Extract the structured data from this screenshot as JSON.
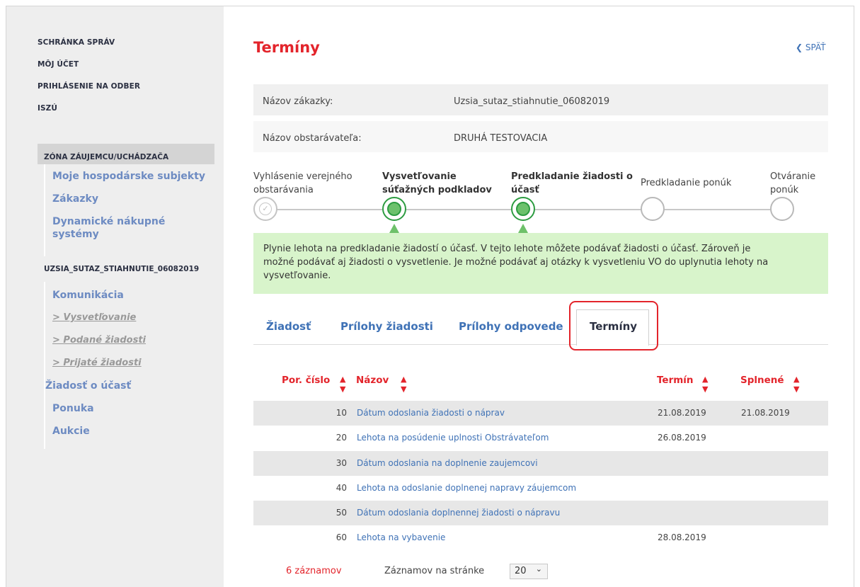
{
  "sidebar": {
    "top_links": [
      "SCHRÁNKA SPRÁV",
      "MÔJ ÚČET",
      "PRIHLÁSENIE NA ODBER",
      "ISZÚ"
    ],
    "zone_header": "ZÓNA ZÁUJEMCU/UCHÁDZAČA",
    "zone_items": [
      "Moje hospodárske subjekty",
      "Zákazky",
      "Dynamické nákupné systémy"
    ],
    "section_header": "UZSIA_SUTAZ_STIAHNUTIE_06082019",
    "section_items": [
      "Komunikácia"
    ],
    "sub_items": [
      "> Vysvetľovanie",
      "> Podané žiadosti",
      "> Prijaté žiadosti"
    ],
    "bottom_items": [
      "Žiadosť o účasť",
      "Ponuka",
      "Aukcie"
    ]
  },
  "page": {
    "title": "Termíny",
    "back_label": "SPÄŤ"
  },
  "info": {
    "contract_label": "Názov zákazky:",
    "contract_value": "Uzsia_sutaz_stiahnutie_06082019",
    "buyer_label": "Názov obstarávateľa:",
    "buyer_value": "DRUHÁ TESTOVACIA"
  },
  "stepper": {
    "steps": [
      {
        "line1": "Vyhlásenie verejného",
        "line2": "obstarávania",
        "state": "done"
      },
      {
        "line1": "Vysvetľovanie",
        "line2": "súťažných podkladov",
        "state": "active"
      },
      {
        "line1": "Predkladanie žiadosti o",
        "line2": "účasť",
        "state": "active"
      },
      {
        "line1": "Predkladanie ponúk",
        "line2": "",
        "state": "pending"
      },
      {
        "line1": "Otváranie",
        "line2": "ponúk",
        "state": "pending"
      }
    ]
  },
  "notice": {
    "line1": "Plynie lehota na predkladanie žiadostí o účasť. V tejto lehote môžete podávať žiadosti o účasť. Zároveň je",
    "line2": "možné podávať aj žiadosti o vysvetlenie. Je možné podávať aj otázky k vysvetleniu VO do uplynutia lehoty na",
    "line3": "vysvetľovanie."
  },
  "tabs": [
    "Žiadosť",
    "Prílohy žiadosti",
    "Prílohy odpovede",
    "Termíny"
  ],
  "table": {
    "headers": [
      "Por. číslo",
      "Názov",
      "Termín",
      "Splnené"
    ],
    "rows": [
      {
        "num": "10",
        "name": "Dátum odoslania žiadosti o náprav",
        "term": "21.08.2019",
        "done": "21.08.2019"
      },
      {
        "num": "20",
        "name": "Lehota na posúdenie uplnosti Obstrávateľom",
        "term": "26.08.2019",
        "done": ""
      },
      {
        "num": "30",
        "name": "Dátum odoslania na doplnenie zaujemcovi",
        "term": "",
        "done": ""
      },
      {
        "num": "40",
        "name": "Lehota na odoslanie doplnenej napravy záujemcom",
        "term": "",
        "done": ""
      },
      {
        "num": "50",
        "name": "Dátum odoslania doplnennej žiadosti o nápravu",
        "term": "",
        "done": ""
      },
      {
        "num": "60",
        "name": "Lehota na vybavenie",
        "term": "28.08.2019",
        "done": ""
      }
    ]
  },
  "footer": {
    "records": "6 záznamov",
    "per_page_label": "Záznamov na stránke",
    "per_page_value": "20"
  },
  "colors": {
    "accent": "#e3242b",
    "link": "#3f72b6",
    "nav_link": "#6d8bc2",
    "success": "#2d9c41",
    "notice_bg": "#d8f4cb"
  },
  "icons": {
    "back": "chevron-left-icon",
    "sort": "sort-icon",
    "check": "check-icon",
    "select": "chevron-down-icon"
  }
}
